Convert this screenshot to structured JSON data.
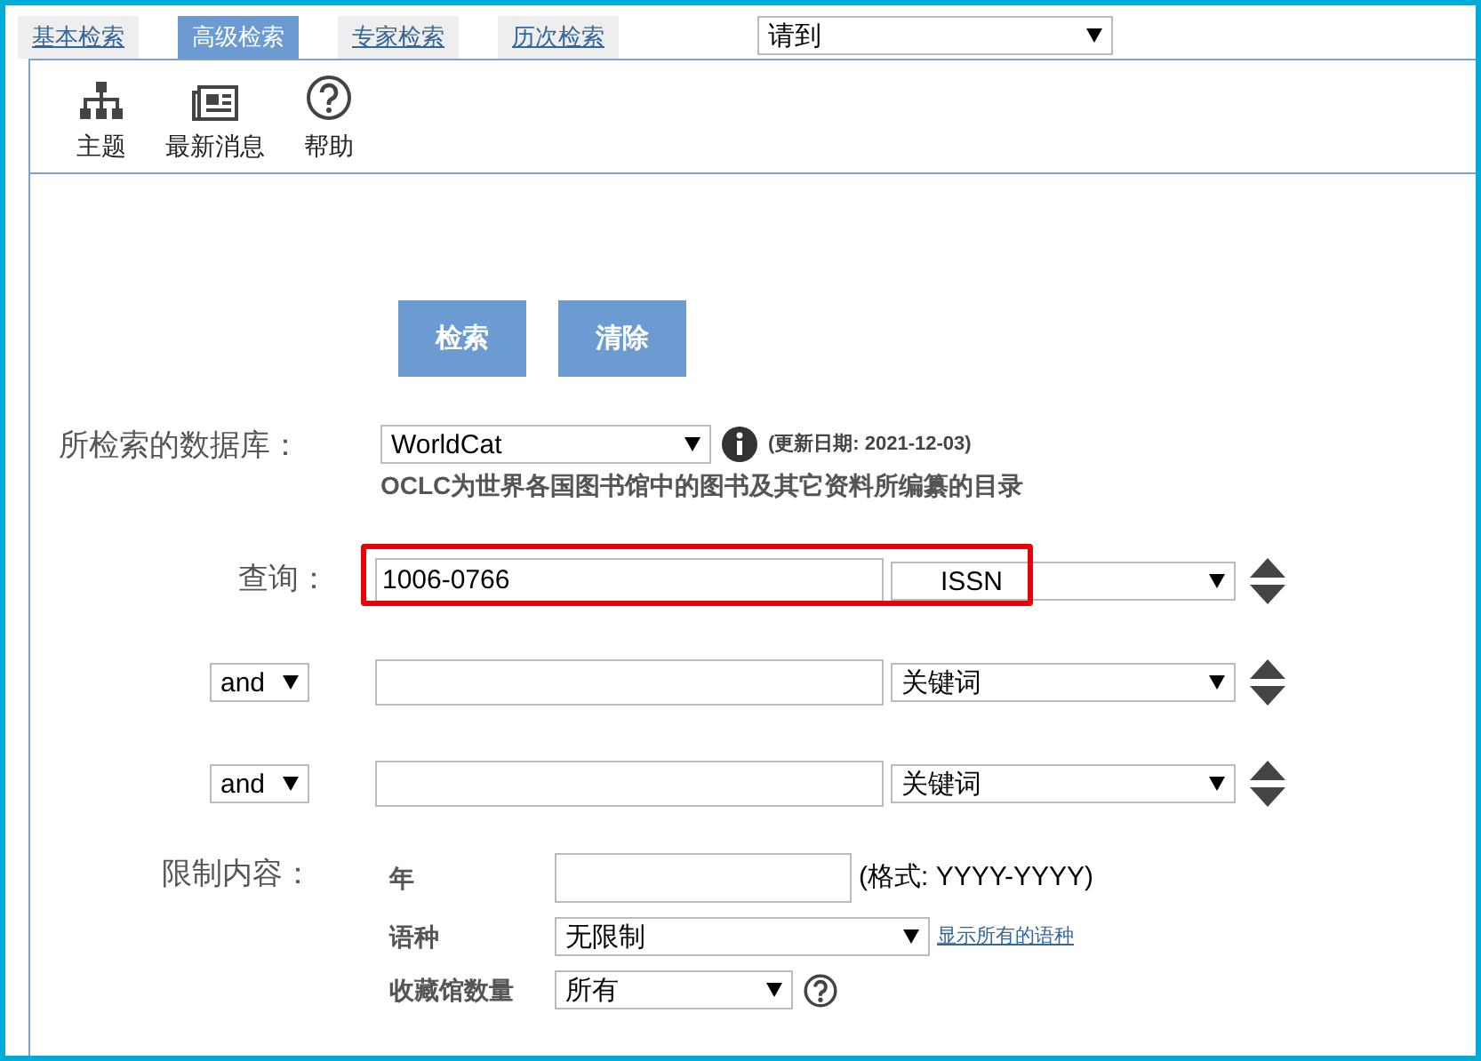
{
  "tabs": [
    {
      "label": "基本检索",
      "selected": false
    },
    {
      "label": "高级检索",
      "selected": true
    },
    {
      "label": "专家检索",
      "selected": false
    },
    {
      "label": "历次检索",
      "selected": false
    }
  ],
  "goto_select": {
    "value": "请到"
  },
  "toolbar": [
    {
      "kind": "subject",
      "label": "主题"
    },
    {
      "kind": "news",
      "label": "最新消息"
    },
    {
      "kind": "help",
      "label": "帮助"
    }
  ],
  "buttons": [
    "检索",
    "清除"
  ],
  "database": {
    "label": "所检索的数据库：",
    "value": "WorldCat",
    "updated": "(更新日期: 2021-12-03)",
    "description": "OCLC为世界各国图书馆中的图书及其它资料所编纂的目录"
  },
  "query_rows": [
    {
      "label": "查询：",
      "value": "1006-0766",
      "field": "ISSN",
      "highlighted": true
    },
    {
      "operator": "and",
      "field": "关键词",
      "highlighted": false
    },
    {
      "operator": "and",
      "field": "关键词",
      "highlighted": false
    }
  ],
  "limits": {
    "label": "限制内容：",
    "year_label": "年",
    "year_format": "(格式: YYYY-YYYY)",
    "language_label": "语种",
    "language_value": "无限制",
    "language_link": "显示所有的语种",
    "holdings_label": "收藏馆数量",
    "holdings_value": "所有"
  }
}
